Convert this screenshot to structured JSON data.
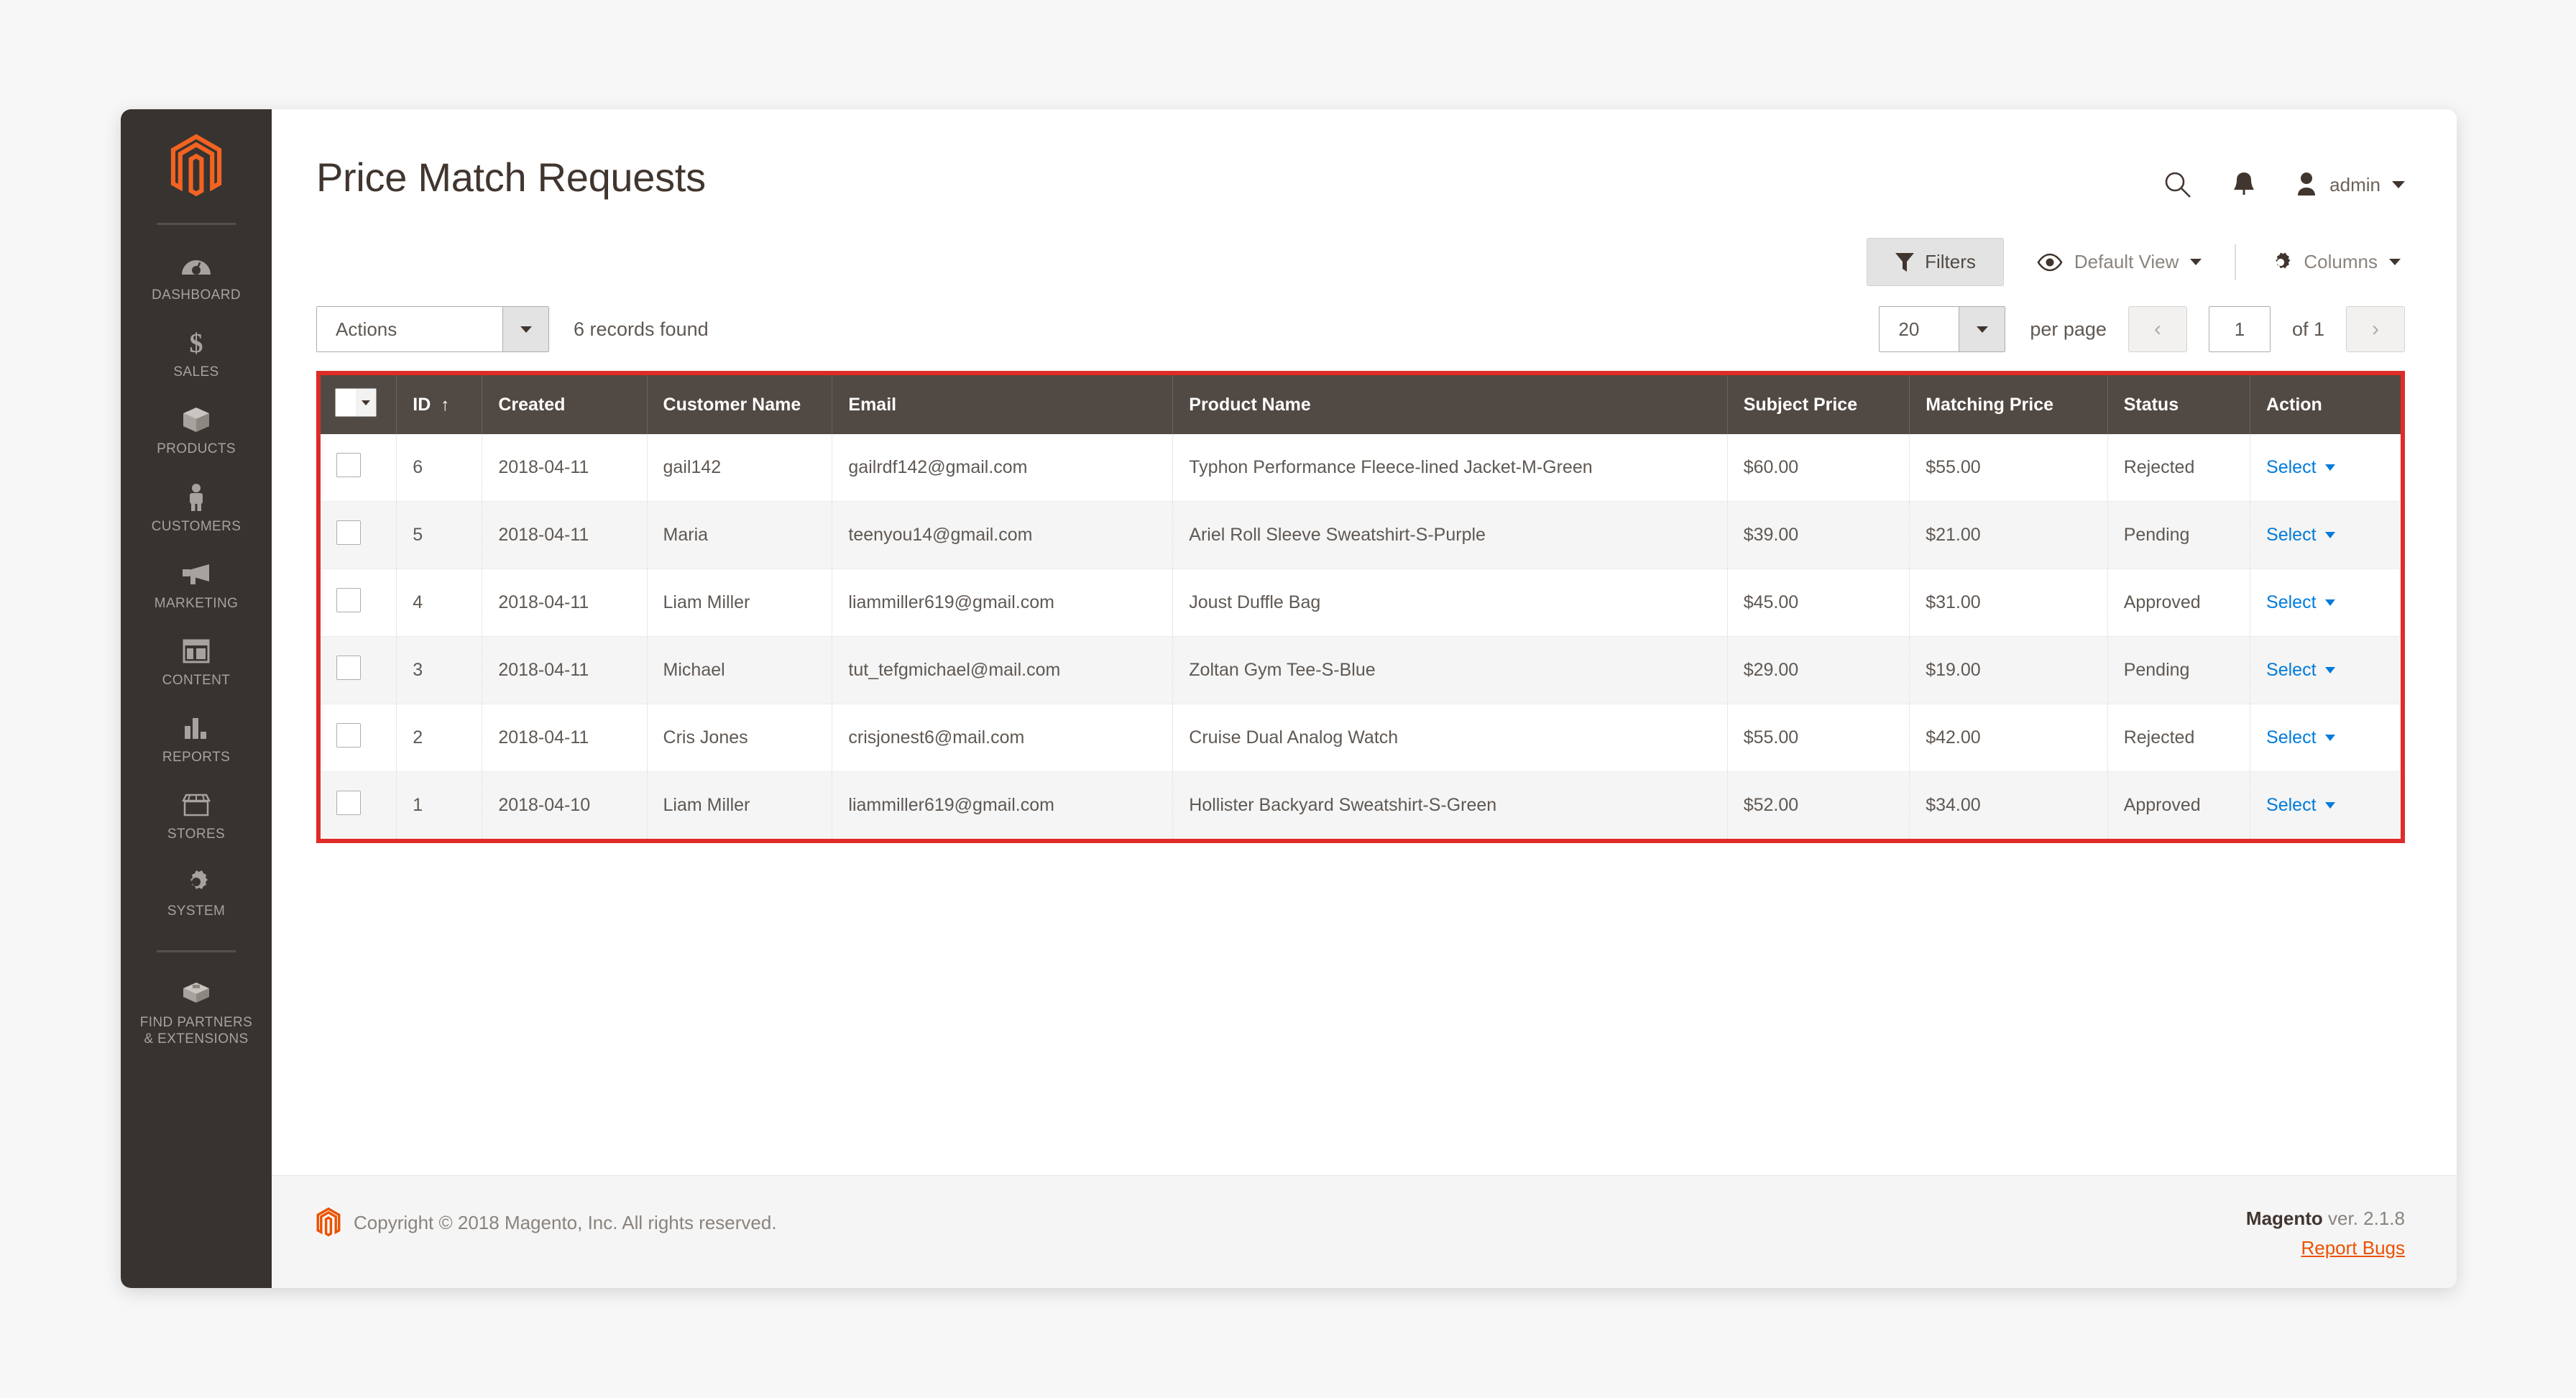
{
  "sidebar": {
    "logo_icon": "magento-logo-icon",
    "items": [
      {
        "label": "DASHBOARD",
        "icon": "dashboard-gauge-icon"
      },
      {
        "label": "SALES",
        "icon": "dollar-sign-icon"
      },
      {
        "label": "PRODUCTS",
        "icon": "box-package-icon"
      },
      {
        "label": "CUSTOMERS",
        "icon": "person-icon"
      },
      {
        "label": "MARKETING",
        "icon": "megaphone-icon"
      },
      {
        "label": "CONTENT",
        "icon": "layout-page-icon"
      },
      {
        "label": "REPORTS",
        "icon": "bar-chart-icon"
      },
      {
        "label": "STORES",
        "icon": "storefront-icon"
      },
      {
        "label": "SYSTEM",
        "icon": "gear-icon"
      },
      {
        "label": "FIND PARTNERS\n& EXTENSIONS",
        "icon": "extension-cube-icon"
      }
    ]
  },
  "header": {
    "title": "Price Match Requests",
    "search_icon": "search-icon",
    "notifications_icon": "bell-icon",
    "user_icon": "user-avatar-icon",
    "admin_label": "admin"
  },
  "toolbar": {
    "filters_label": "Filters",
    "filters_icon": "funnel-icon",
    "view_label": "Default View",
    "view_icon": "eye-icon",
    "columns_label": "Columns",
    "columns_icon": "gear-icon"
  },
  "controls": {
    "actions_value": "Actions",
    "records_found": "6 records found",
    "per_page_value": "20",
    "per_page_label": "per page",
    "prev_icon": "chevron-left-icon",
    "next_icon": "chevron-right-icon",
    "current_page": "1",
    "page_of": "of 1"
  },
  "grid": {
    "select_all_icon": "select-all-dropdown-icon",
    "sort_indicator": "↑",
    "columns": [
      "ID",
      "Created",
      "Customer Name",
      "Email",
      "Product Name",
      "Subject Price",
      "Matching Price",
      "Status",
      "Action"
    ],
    "action_label": "Select",
    "rows": [
      {
        "id": "6",
        "created": "2018-04-11",
        "customer": "gail142",
        "email": "gailrdf142@gmail.com",
        "product": "Typhon Performance Fleece-lined Jacket-M-Green",
        "subject_price": "$60.00",
        "matching_price": "$55.00",
        "status": "Rejected"
      },
      {
        "id": "5",
        "created": "2018-04-11",
        "customer": "Maria",
        "email": "teenyou14@gmail.com",
        "product": "Ariel Roll Sleeve Sweatshirt-S-Purple",
        "subject_price": "$39.00",
        "matching_price": "$21.00",
        "status": "Pending"
      },
      {
        "id": "4",
        "created": "2018-04-11",
        "customer": "Liam Miller",
        "email": "liammiller619@gmail.com",
        "product": "Joust Duffle Bag",
        "subject_price": "$45.00",
        "matching_price": "$31.00",
        "status": "Approved"
      },
      {
        "id": "3",
        "created": "2018-04-11",
        "customer": "Michael",
        "email": "tut_tefgmichael@mail.com",
        "product": "Zoltan Gym Tee-S-Blue",
        "subject_price": "$29.00",
        "matching_price": "$19.00",
        "status": "Pending"
      },
      {
        "id": "2",
        "created": "2018-04-11",
        "customer": "Cris Jones",
        "email": "crisjonest6@mail.com",
        "product": "Cruise Dual Analog Watch",
        "subject_price": "$55.00",
        "matching_price": "$42.00",
        "status": "Rejected"
      },
      {
        "id": "1",
        "created": "2018-04-10",
        "customer": "Liam Miller",
        "email": "liammiller619@gmail.com",
        "product": "Hollister Backyard Sweatshirt-S-Green",
        "subject_price": "$52.00",
        "matching_price": "$34.00",
        "status": "Approved"
      }
    ]
  },
  "footer": {
    "logo_icon": "magento-logo-icon",
    "copyright": "Copyright © 2018 Magento, Inc. All rights reserved.",
    "brand": "Magento",
    "version": " ver. 2.1.8",
    "report_bugs": "Report Bugs"
  },
  "colors": {
    "sidebar_bg": "#373330",
    "accent_orange": "#eb5202",
    "header_row_bg": "#514943",
    "highlight_border": "#e02b27",
    "link_blue": "#007bdb"
  }
}
